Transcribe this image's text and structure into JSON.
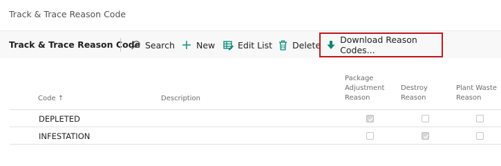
{
  "page": {
    "title": "Track & Trace Reason Code"
  },
  "action_bar": {
    "list_name": "Track & Trace Reason Code",
    "actions": [
      {
        "label": "Search",
        "icon": "search-icon"
      },
      {
        "label": "New",
        "icon": "plus-icon"
      },
      {
        "label": "Edit List",
        "icon": "edit-list-icon"
      },
      {
        "label": "Delete",
        "icon": "trash-icon"
      },
      {
        "label": "Download Reason Codes...",
        "icon": "download-arrow-icon"
      }
    ],
    "highlight_color": "#c0161e",
    "accent_color": "#008575"
  },
  "table": {
    "columns": {
      "code": "Code",
      "code_sort": "↑",
      "description": "Description",
      "package_adjustment_reason": [
        "Package",
        "Adjustment",
        "Reason"
      ],
      "destroy_reason": [
        "Destroy",
        "Reason"
      ],
      "plant_waste_reason": [
        "Plant Waste",
        "Reason"
      ]
    },
    "rows": [
      {
        "code": "DEPLETED",
        "description": "",
        "package_adjustment_reason": true,
        "destroy_reason": false,
        "plant_waste_reason": false
      },
      {
        "code": "INFESTATION",
        "description": "",
        "package_adjustment_reason": false,
        "destroy_reason": true,
        "plant_waste_reason": false
      }
    ]
  }
}
